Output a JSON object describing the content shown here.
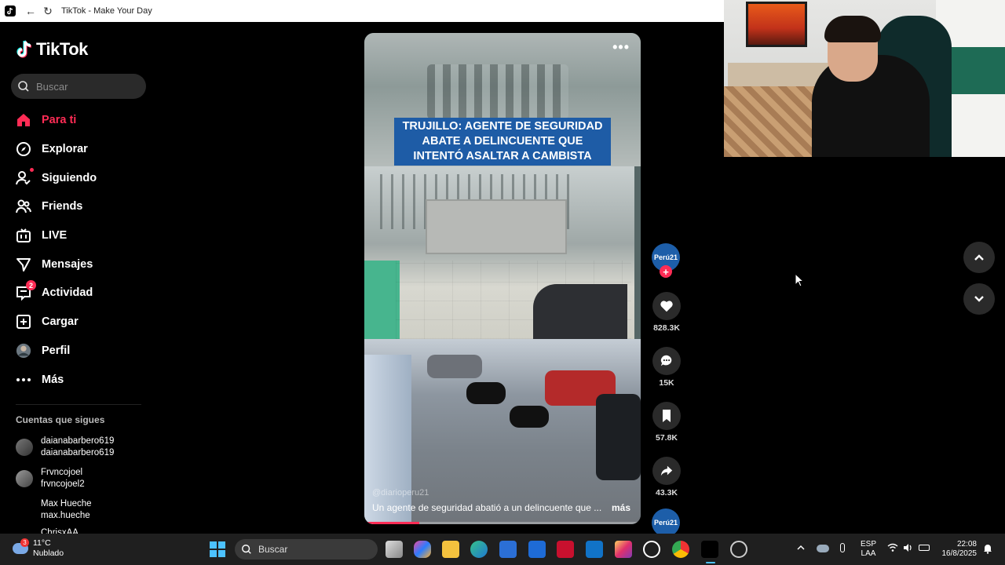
{
  "browser": {
    "tab_title": "TikTok - Make Your Day"
  },
  "sidebar": {
    "logo_text": "TikTok",
    "search_placeholder": "Buscar",
    "menu": [
      {
        "label": "Para ti",
        "icon": "home-icon",
        "active": true
      },
      {
        "label": "Explorar",
        "icon": "compass-icon"
      },
      {
        "label": "Siguiendo",
        "icon": "following-icon"
      },
      {
        "label": "Friends",
        "icon": "friends-icon"
      },
      {
        "label": "LIVE",
        "icon": "live-icon"
      },
      {
        "label": "Mensajes",
        "icon": "messages-icon"
      },
      {
        "label": "Actividad",
        "icon": "activity-icon",
        "badge": "2"
      },
      {
        "label": "Cargar",
        "icon": "upload-icon"
      },
      {
        "label": "Perfil",
        "icon": "profile-avatar"
      },
      {
        "label": "Más",
        "icon": "more-icon"
      }
    ],
    "following_title": "Cuentas que sigues",
    "following": [
      {
        "name": "daianabarbero619",
        "handle": "daianabarbero619"
      },
      {
        "name": "Frvncojoel",
        "handle": "frvncojoel2"
      },
      {
        "name": "Max Hueche",
        "handle": "max.hueche"
      },
      {
        "name": "ChrisxAA",
        "handle": ""
      }
    ]
  },
  "video": {
    "headline": "TRUJILLO: AGENTE DE SEGURIDAD ABATE A DELINCUENTE QUE INTENTÓ ASALTAR A CAMBISTA",
    "caption": "Un agente de seguridad abatió a un delincuente que ...",
    "more_label": "más",
    "watermark": "@diarioperu21",
    "progress": 0.2
  },
  "actions": {
    "creator_label": "Perú21",
    "likes": "828.3K",
    "comments": "15K",
    "saves": "57.8K",
    "shares": "43.3K"
  },
  "taskbar": {
    "weather_temp": "11°C",
    "weather_desc": "Nublado",
    "weather_badge": "3",
    "search_placeholder": "Buscar",
    "lang_line1": "ESP",
    "lang_line2": "LAA",
    "time": "22:08",
    "date": "16/8/2025"
  },
  "colors": {
    "accent": "#fe2c55",
    "brand_blue": "#1e5ca6",
    "background": "#000000"
  }
}
